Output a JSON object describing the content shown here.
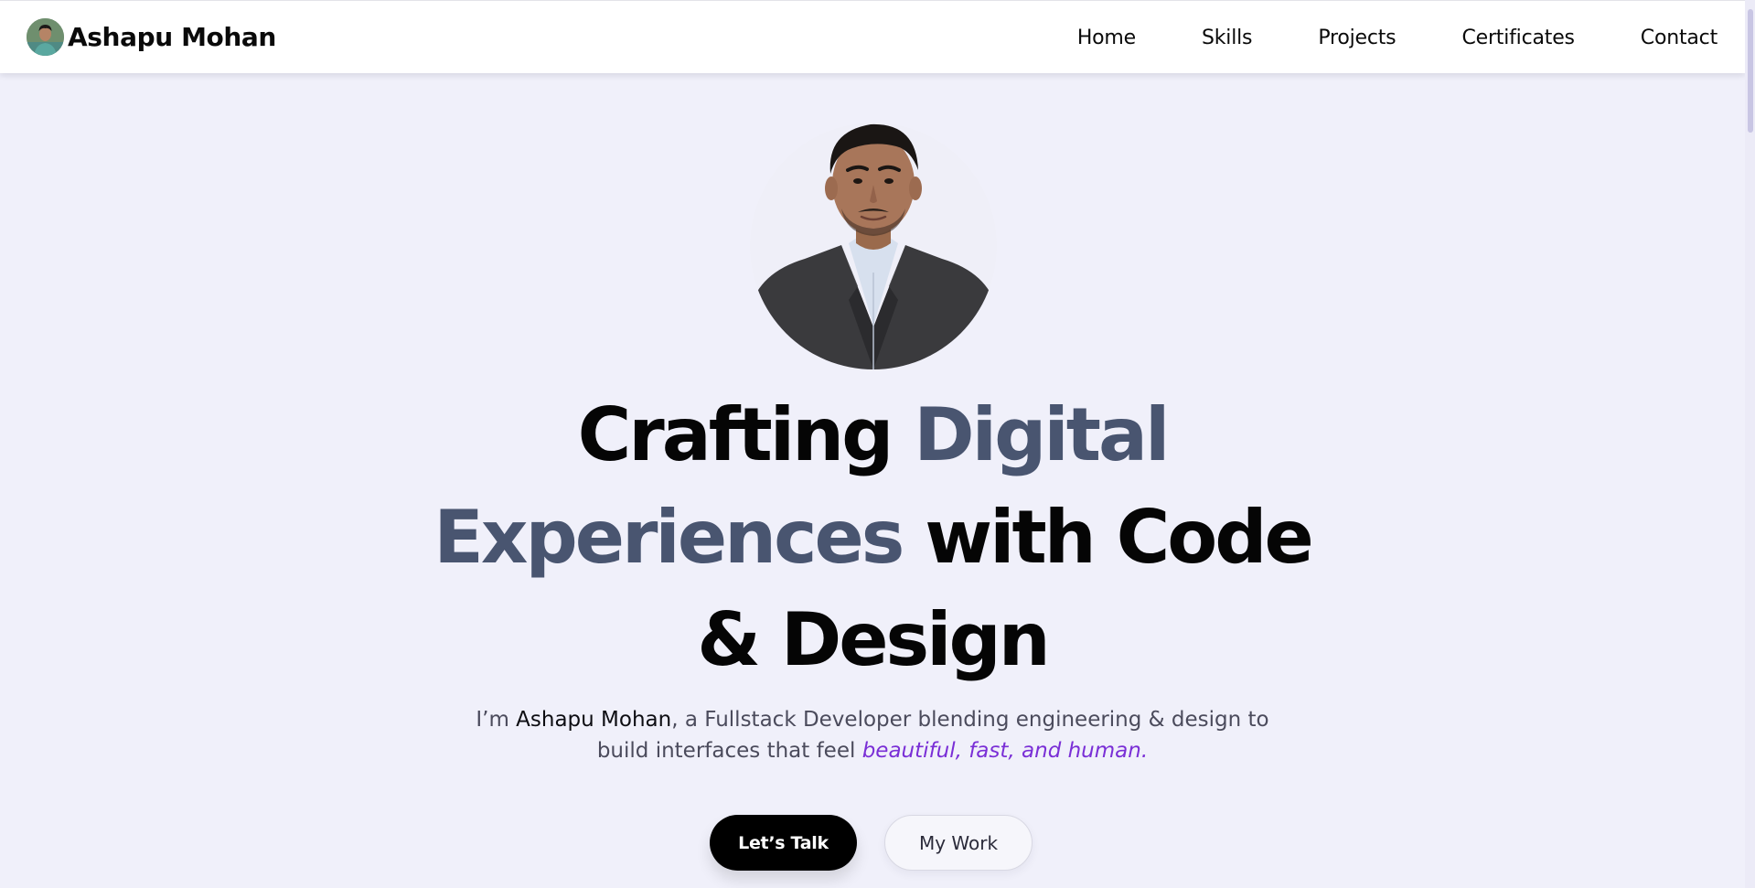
{
  "brand": {
    "name": "Ashapu Mohan"
  },
  "nav": {
    "items": [
      {
        "label": "Home"
      },
      {
        "label": "Skills"
      },
      {
        "label": "Projects"
      },
      {
        "label": "Certificates"
      },
      {
        "label": "Contact"
      }
    ]
  },
  "hero": {
    "headline": {
      "part1": "Crafting ",
      "part2": "Digital Experiences",
      "part3": " with Code & Design"
    },
    "intro": {
      "prefix": "I’m ",
      "name": "Ashapu Mohan",
      "middle": ", a Fullstack Developer blending engineering & design to build interfaces that feel ",
      "highlight": "beautiful, fast, and human",
      "suffix": "."
    },
    "primary_button": "Let’s Talk",
    "secondary_button": "My Work"
  },
  "colors": {
    "background": "#f0f0fa",
    "headline_accent": "#495570",
    "intro_highlight": "#7a2fd6",
    "primary_button": "#000000"
  }
}
